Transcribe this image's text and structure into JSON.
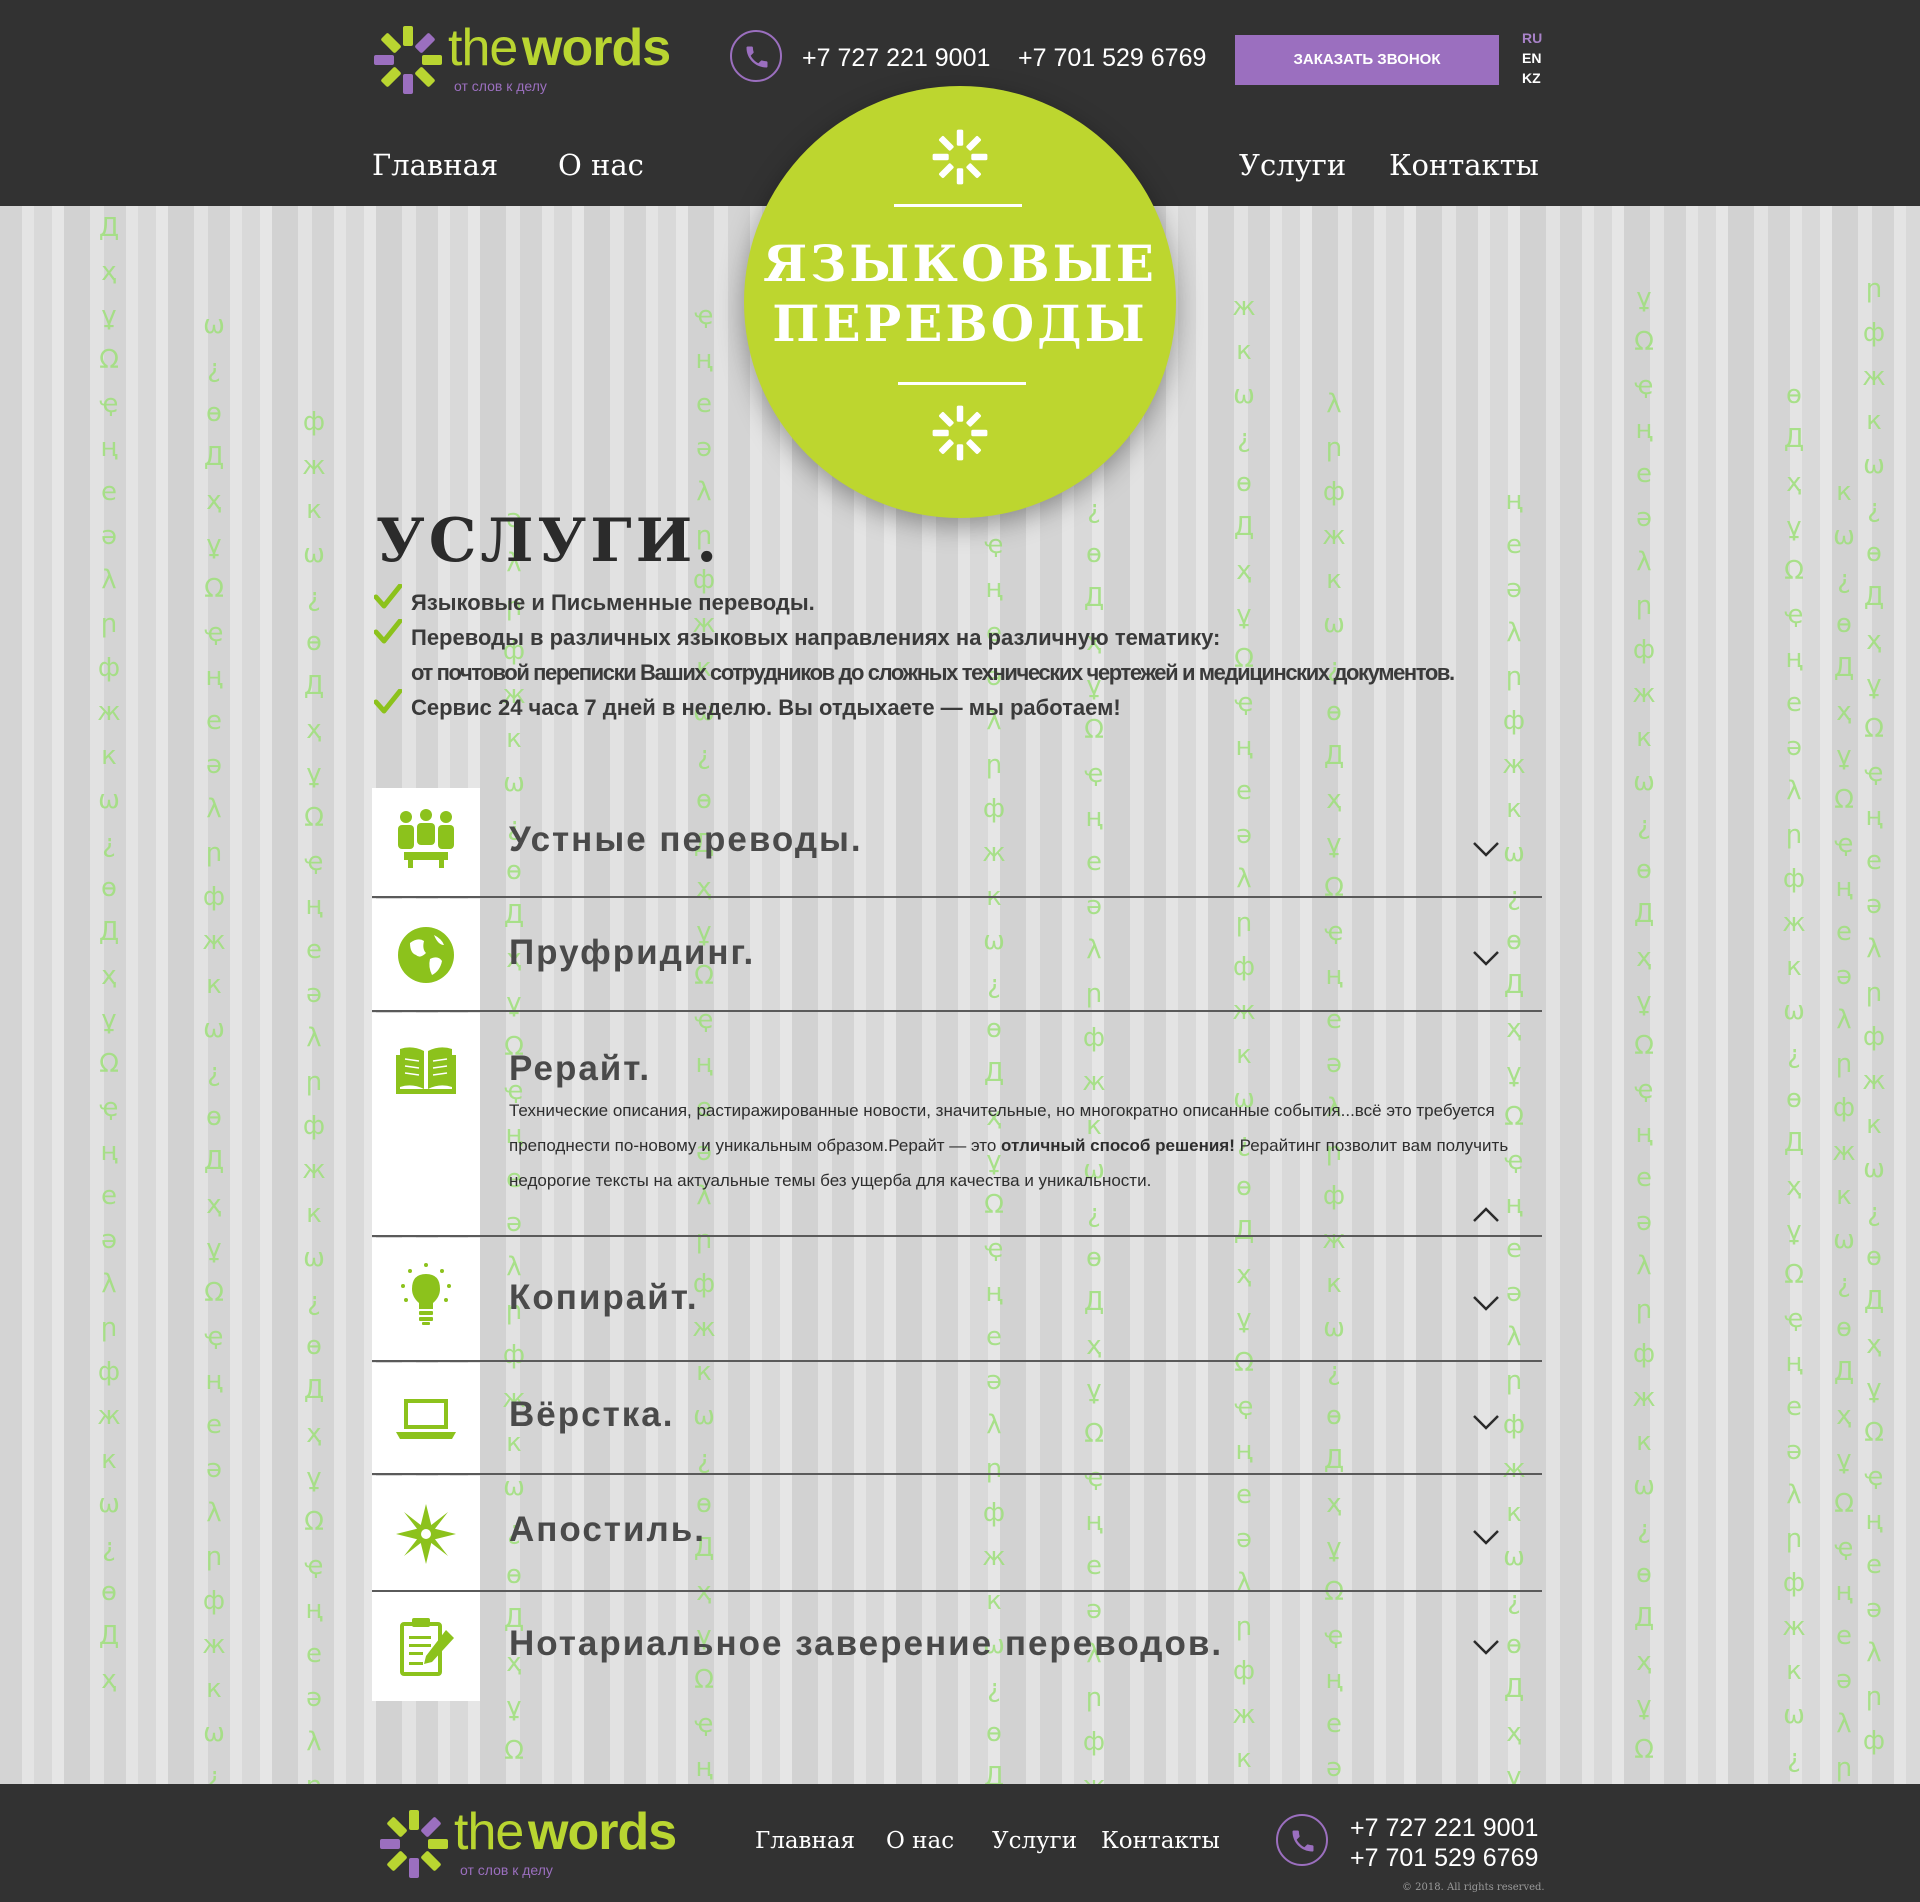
{
  "header": {
    "logo": {
      "the": "the",
      "words": "words",
      "tagline": "от слов к делу"
    },
    "phones": [
      "+7 727 221 9001",
      "+7 701 529 6769"
    ],
    "call_button": "ЗАКАЗАТЬ ЗВОНОК",
    "languages": [
      "RU",
      "EN",
      "KZ"
    ],
    "active_language": "RU",
    "nav": [
      "Главная",
      "О нас",
      "Услуги",
      "Контакты"
    ]
  },
  "hero": {
    "title_line1": "ЯЗЫКОВЫЕ",
    "title_line2": "ПЕРЕВОДЫ"
  },
  "services": {
    "heading": "УСЛУГИ.",
    "features": [
      "Языковые и Письменные переводы.",
      "Переводы в различных языковых направлениях на различную тематику:",
      "от почтовой переписки Ваших сотрудников до сложных технических чертежей и медицинских документов.",
      "Сервис 24 часа 7 дней в неделю. Вы отдыхаете — мы работаем!"
    ],
    "items": [
      {
        "title": "Устные переводы.",
        "icon": "people-icon"
      },
      {
        "title": "Пруфридинг.",
        "icon": "globe-icon"
      },
      {
        "title": "Рерайт.",
        "icon": "book-icon",
        "desc_before": "Технические описания, растиражированные новости, значительные, но многократно описанные события...всё это требуется преподнести по-новому и уникальным образом.Рерайт — это ",
        "desc_bold": "отличный способ решения!",
        "desc_after": " Рерайтинг позволит вам получить недорогие тексты на актуальные темы без ущерба для качества и уникальности."
      },
      {
        "title": "Копирайт.",
        "icon": "lightbulb-icon"
      },
      {
        "title": "Вёрстка.",
        "icon": "laptop-icon"
      },
      {
        "title": "Апостиль.",
        "icon": "compass-star-icon"
      },
      {
        "title": "Нотариальное заверение переводов.",
        "icon": "document-pen-icon"
      }
    ]
  },
  "footer": {
    "nav": [
      "Главная",
      "О нас",
      "Услуги",
      "Контакты"
    ],
    "phones": [
      "+7 727 221 9001",
      "+7 701 529 6769"
    ],
    "copyright": "© 2018. All rights reserved."
  },
  "colors": {
    "dark": "#323232",
    "lime": "#bdd62f",
    "purple": "#9b6fbf",
    "matrix_green": "#9ee07a"
  }
}
